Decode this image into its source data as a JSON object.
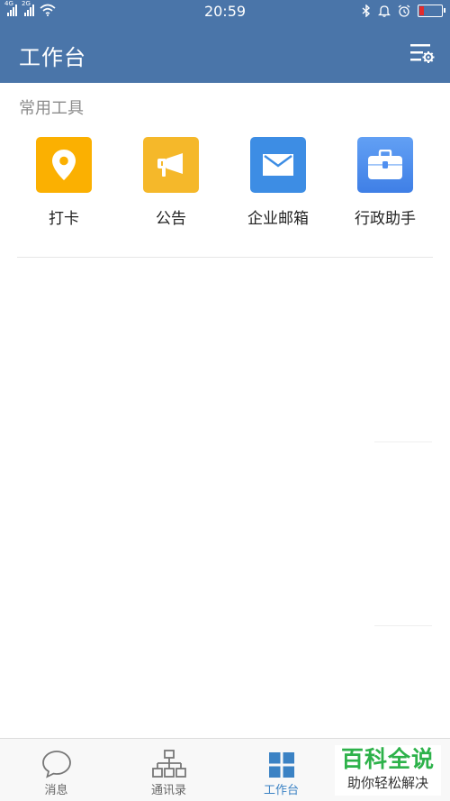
{
  "status_bar": {
    "network_1": "4G",
    "network_2": "2G",
    "time": "20:59",
    "icons": [
      "bluetooth-icon",
      "alarm-bell-icon",
      "alarm-clock-icon",
      "battery-low-icon"
    ]
  },
  "header": {
    "title": "工作台",
    "settings_icon": "settings-list-icon"
  },
  "section": {
    "label": "常用工具"
  },
  "tools": [
    {
      "label": "打卡",
      "icon": "location-pin-icon",
      "color": "#fbb001"
    },
    {
      "label": "公告",
      "icon": "megaphone-icon",
      "color": "#f5b82a"
    },
    {
      "label": "企业邮箱",
      "icon": "envelope-icon",
      "color": "#3d8de4"
    },
    {
      "label": "行政助手",
      "icon": "briefcase-icon",
      "color": "#4f8ff0"
    }
  ],
  "tabbar": {
    "items": [
      {
        "label": "消息",
        "icon": "chat-bubble-icon",
        "active": false
      },
      {
        "label": "通讯录",
        "icon": "org-chart-icon",
        "active": false
      },
      {
        "label": "工作台",
        "icon": "grid-icon",
        "active": true
      },
      {
        "label": "",
        "icon": "",
        "active": false
      }
    ],
    "active_color": "#3b82c4"
  },
  "watermark": {
    "title": "百科全说",
    "subtitle": "助你轻松解决"
  }
}
